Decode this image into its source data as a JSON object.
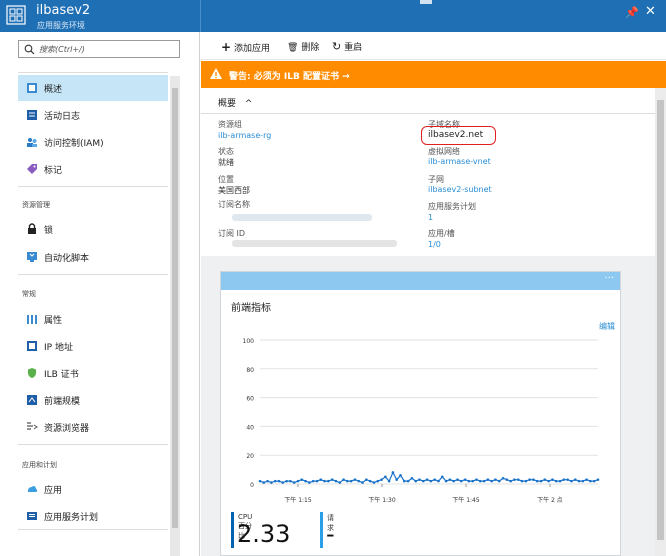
{
  "window": {
    "title": "ilbasev2",
    "subtitle": "应用服务环境",
    "icons": {
      "logo": "app-service-environment-icon",
      "pin": "pin-icon",
      "close": "close-icon"
    }
  },
  "sidebar": {
    "search_placeholder": "搜索(Ctrl+/)",
    "items_top": [
      {
        "label": "概述",
        "icon": "overview-icon"
      },
      {
        "label": "活动日志",
        "icon": "activity-log-icon"
      },
      {
        "label": "访问控制(IAM)",
        "icon": "iam-icon"
      },
      {
        "label": "标记",
        "icon": "tag-icon"
      }
    ],
    "section_resource": "资源管理",
    "items_resource": [
      {
        "label": "锁",
        "icon": "lock-icon"
      },
      {
        "label": "自动化脚本",
        "icon": "automation-script-icon"
      }
    ],
    "section_general": "常规",
    "items_general": [
      {
        "label": "属性",
        "icon": "properties-icon"
      },
      {
        "label": "IP 地址",
        "icon": "ip-address-icon"
      },
      {
        "label": "ILB 证书",
        "icon": "certificate-icon"
      },
      {
        "label": "前端规模",
        "icon": "scale-icon"
      },
      {
        "label": "资源浏览器",
        "icon": "resource-explorer-icon"
      }
    ],
    "section_apps": "应用和计划",
    "items_apps": [
      {
        "label": "应用",
        "icon": "app-icon"
      },
      {
        "label": "应用服务计划",
        "icon": "plan-icon"
      }
    ]
  },
  "toolbar": {
    "add_app": "添加应用",
    "delete": "删除",
    "restart": "重启"
  },
  "warning": {
    "text": "警告: 必须为 ILB 配置证书 →",
    "color": "#ff8c00"
  },
  "essentials": {
    "header": "概要",
    "left": [
      {
        "key": "资源组",
        "value": "ilb-armase-rg",
        "link": true
      },
      {
        "key": "状态",
        "value": "就绪",
        "link": false
      },
      {
        "key": "位置",
        "value": "美国西部",
        "link": false
      },
      {
        "key": "订阅名称",
        "value": "",
        "link": true
      },
      {
        "key": "订阅 ID",
        "value": "",
        "link": false
      }
    ],
    "right": [
      {
        "key": "子域名称",
        "value": "ilbasev2.net",
        "link": false
      },
      {
        "key": "虚拟网络",
        "value": "ilb-armase-vnet",
        "link": true
      },
      {
        "key": "子网",
        "value": "ilbasev2-subnet",
        "link": true
      },
      {
        "key": "应用服务计划",
        "value": "1",
        "link": true
      },
      {
        "key": "应用/槽",
        "value": "1/0",
        "link": true
      }
    ]
  },
  "tile": {
    "title": "前端指标",
    "edit": "编辑",
    "more": "···",
    "metrics": [
      {
        "caption": "CPU 百分比",
        "value": "2.33",
        "color": "#0063b1"
      },
      {
        "caption": "请求",
        "value": "-",
        "color": "#2aa0e8"
      }
    ]
  },
  "chart_data": {
    "type": "line",
    "title": "前端指标",
    "xlabel": "",
    "ylabel": "",
    "ylim": [
      0,
      100
    ],
    "yticks": [
      0,
      20,
      40,
      60,
      80,
      100
    ],
    "xticks": [
      "下午 1:15",
      "下午 1:30",
      "下午 1:45",
      "下午 2 点"
    ],
    "grid": true,
    "series": [
      {
        "name": "CPU 百分比",
        "color": "#1a73c9",
        "values": [
          2,
          1,
          2,
          1,
          2,
          2,
          1,
          2,
          2,
          1,
          2,
          3,
          2,
          1,
          2,
          2,
          3,
          2,
          2,
          3,
          2,
          1,
          3,
          2,
          2,
          3,
          2,
          1,
          3,
          2,
          1,
          2,
          3,
          5,
          2,
          8,
          3,
          6,
          2,
          2,
          4,
          2,
          3,
          2,
          3,
          2,
          3,
          2,
          5,
          2,
          3,
          2,
          3,
          2,
          3,
          2,
          2,
          3,
          2,
          2,
          3,
          2,
          3,
          2,
          4,
          3,
          2,
          3,
          3,
          2,
          2,
          3,
          3,
          2,
          2,
          3,
          2,
          3,
          2,
          2,
          3,
          3,
          2,
          3,
          2,
          2,
          3,
          2,
          2,
          3
        ]
      }
    ]
  }
}
